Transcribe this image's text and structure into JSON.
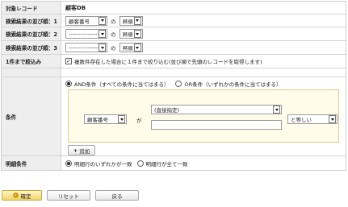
{
  "rows": {
    "target": {
      "label": "対象レコード",
      "value": "顧客DB"
    },
    "sort1": {
      "label": "検索結果の並び順：1",
      "field": "顧客番号",
      "no": "の",
      "order": "昇順"
    },
    "sort2": {
      "label": "検索結果の並び順：2",
      "field": "--------------------",
      "no": "の",
      "order": "昇順"
    },
    "sort3": {
      "label": "検索結果の並び順：3",
      "field": "--------------------",
      "no": "の",
      "order": "昇順"
    },
    "narrow": {
      "label": "1件まで絞込み",
      "checkbox_text": "複数件存在した場合に１件まで絞り込む(並び順で先頭のレコードを取得します)",
      "checked": true
    }
  },
  "condition": {
    "label": "条件",
    "and_option": "AND条件（すべての条件に当てはまる）",
    "or_option": "OR条件（いずれかの条件に当てはまる）",
    "selected": "AND",
    "field": "顧客番号",
    "ga": "が",
    "value_type": "(直接指定)",
    "value": "",
    "operator": "と等しい",
    "add_button": "追加"
  },
  "detail": {
    "label": "明細条件",
    "option1": "明細行のいずれかが一致",
    "option2": "明細行が全て一致",
    "selected": "option1"
  },
  "footer": {
    "confirm": "確定",
    "reset": "リセット",
    "back": "戻る"
  }
}
